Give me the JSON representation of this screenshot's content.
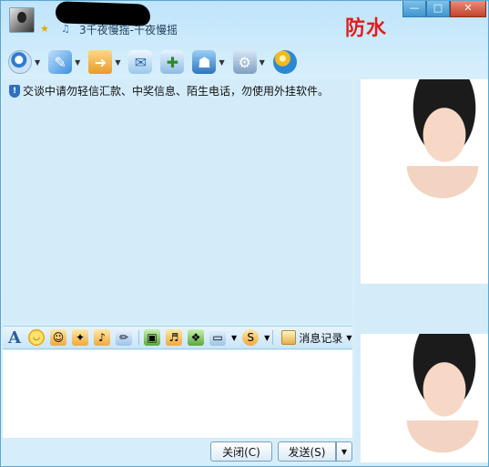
{
  "titlebar": {
    "signature": "3千夜慢摇-千夜慢摇",
    "watermark": "防水",
    "buttons": {
      "minimize": "—",
      "maximize": "□",
      "close": "✕"
    }
  },
  "toolbar": {
    "tools": [
      {
        "icon": "webcam-icon",
        "has_dropdown": true
      },
      {
        "icon": "microphone-icon",
        "has_dropdown": true
      },
      {
        "icon": "folder-transfer-icon",
        "has_dropdown": true
      },
      {
        "icon": "mail-icon",
        "has_dropdown": false
      },
      {
        "icon": "add-note-icon",
        "has_dropdown": false
      },
      {
        "icon": "profile-card-icon",
        "has_dropdown": true
      },
      {
        "icon": "app-settings-icon",
        "has_dropdown": true
      },
      {
        "icon": "qzone-globe-icon",
        "has_dropdown": false
      }
    ],
    "dropdown_glyph": "▼"
  },
  "chat": {
    "security_notice": "交谈中请勿轻信汇款、中奖信息、陌生电话，勿使用外挂软件。"
  },
  "format_bar": {
    "font_label": "A",
    "history_label": "消息记录",
    "dropdown_glyph": "▼"
  },
  "buttons": {
    "close_label": "关闭(C)",
    "send_label": "发送(S)",
    "send_dropdown": "▼"
  },
  "colors": {
    "accent": "#3f95cf",
    "watermark": "#e31b1b",
    "panel": "#d4ecfa"
  }
}
